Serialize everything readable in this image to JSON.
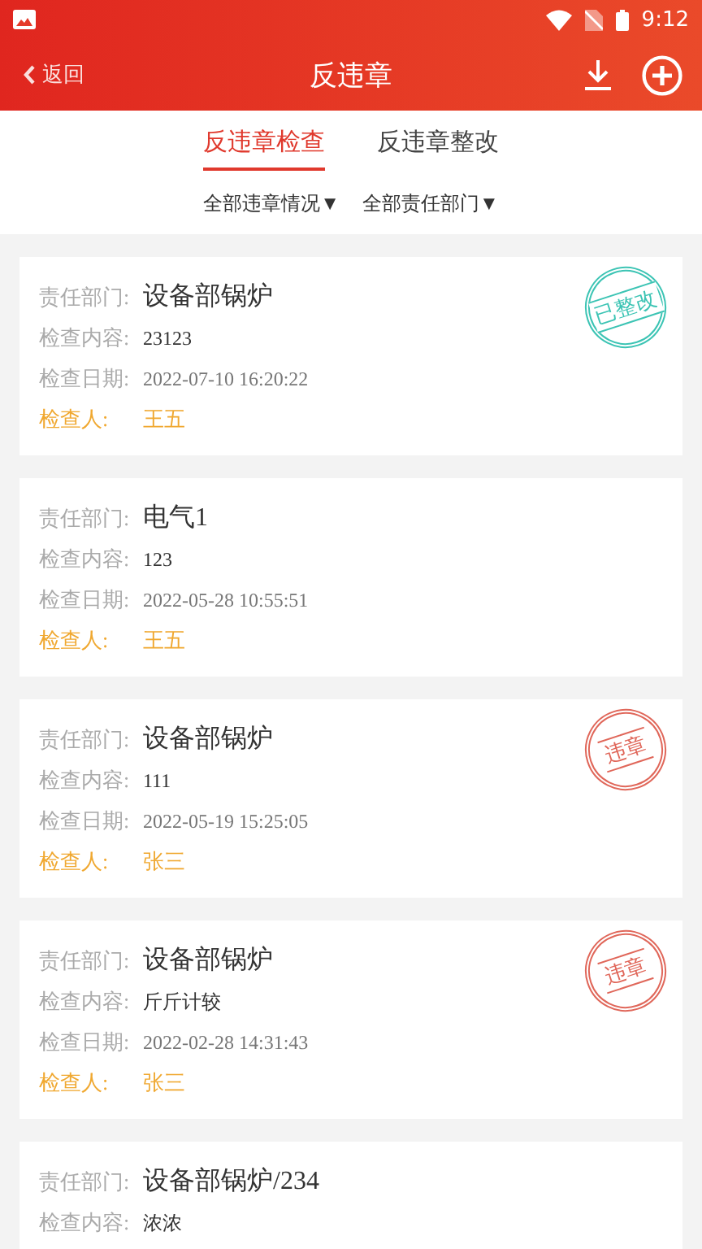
{
  "status_bar": {
    "time": "9:12"
  },
  "header": {
    "back": "返回",
    "title": "反违章"
  },
  "tabs": [
    {
      "label": "反违章检查",
      "selected": true
    },
    {
      "label": "反违章整改",
      "selected": false
    }
  ],
  "filters": [
    {
      "label": "全部违章情况",
      "arrow": "▼"
    },
    {
      "label": "全部责任部门",
      "arrow": "▼"
    }
  ],
  "records": [
    {
      "fields": [
        {
          "kind": "dept",
          "label": "责任部门:",
          "value": "设备部锅炉"
        },
        {
          "kind": "content",
          "label": "检查内容:",
          "value": "23123"
        },
        {
          "kind": "date",
          "label": "检查日期:",
          "value": "2022-07-10 16:20:22"
        },
        {
          "kind": "inspector",
          "label": "检查人:",
          "value": "王五"
        }
      ],
      "stamp": {
        "kind": "rectified",
        "text": "已整改"
      }
    },
    {
      "fields": [
        {
          "kind": "dept",
          "label": "责任部门:",
          "value": "电气1"
        },
        {
          "kind": "content",
          "label": "检查内容:",
          "value": "123"
        },
        {
          "kind": "date",
          "label": "检查日期:",
          "value": "2022-05-28 10:55:51"
        },
        {
          "kind": "inspector",
          "label": "检查人:",
          "value": "王五"
        }
      ]
    },
    {
      "fields": [
        {
          "kind": "dept",
          "label": "责任部门:",
          "value": "设备部锅炉"
        },
        {
          "kind": "content",
          "label": "检查内容:",
          "value": "111"
        },
        {
          "kind": "date",
          "label": "检查日期:",
          "value": "2022-05-19 15:25:05"
        },
        {
          "kind": "inspector",
          "label": "检查人:",
          "value": "张三"
        }
      ],
      "stamp": {
        "kind": "violation",
        "text": "违章"
      }
    },
    {
      "fields": [
        {
          "kind": "dept",
          "label": "责任部门:",
          "value": "设备部锅炉"
        },
        {
          "kind": "content",
          "label": "检查内容:",
          "value": "斤斤计较"
        },
        {
          "kind": "date",
          "label": "检查日期:",
          "value": "2022-02-28 14:31:43"
        },
        {
          "kind": "inspector",
          "label": "检查人:",
          "value": "张三"
        }
      ],
      "stamp": {
        "kind": "violation",
        "text": "违章"
      }
    },
    {
      "fields": [
        {
          "kind": "dept",
          "label": "责任部门:",
          "value": "设备部锅炉/234"
        },
        {
          "kind": "content",
          "label": "检查内容:",
          "value": "浓浓"
        }
      ]
    }
  ]
}
